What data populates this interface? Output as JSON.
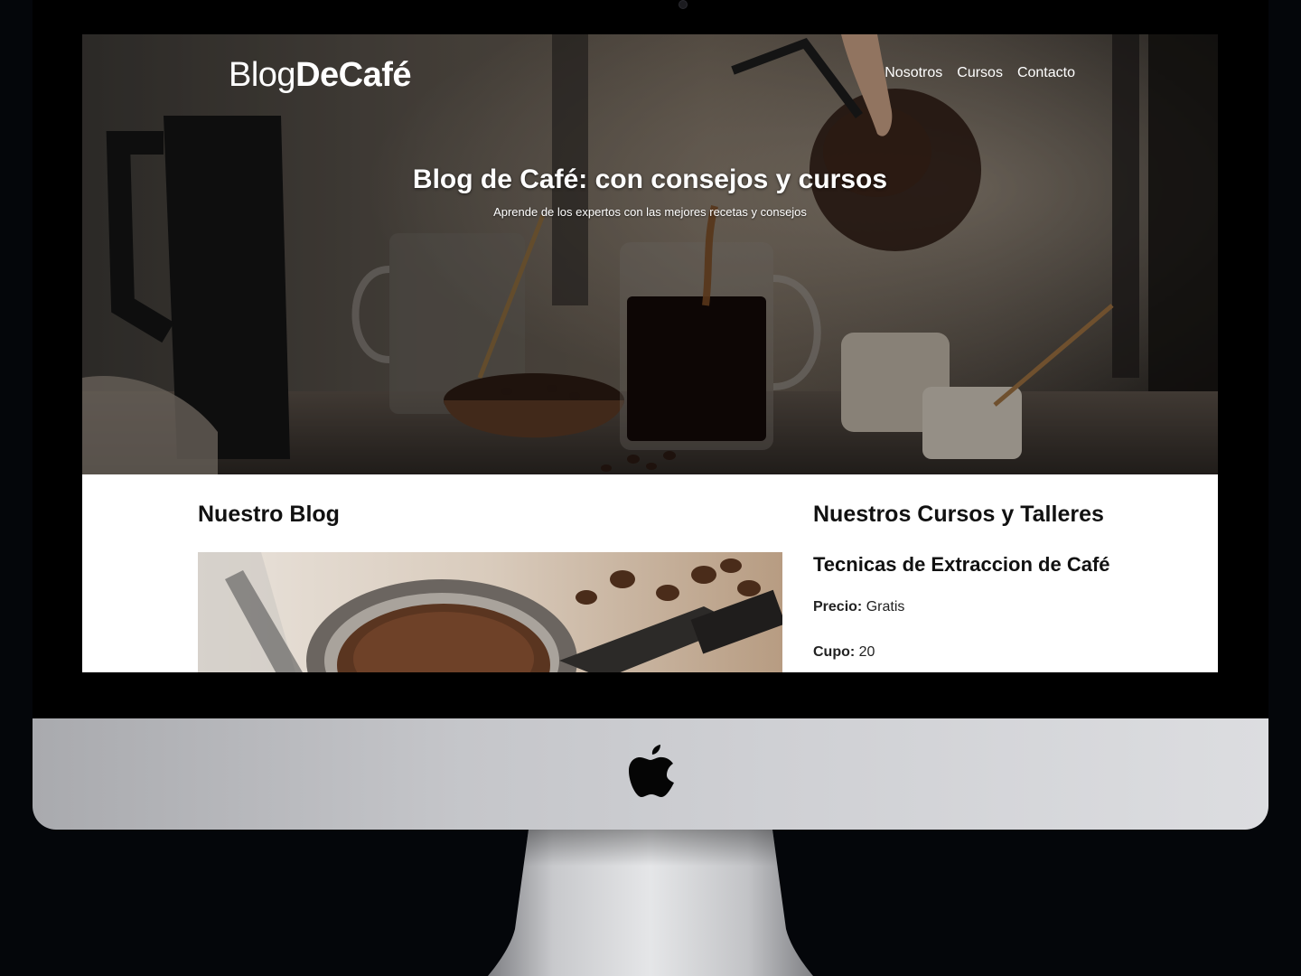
{
  "site": {
    "logo_light": "Blog",
    "logo_bold": "DeCafé",
    "nav": [
      {
        "label": "Nosotros"
      },
      {
        "label": "Cursos"
      },
      {
        "label": "Contacto"
      }
    ]
  },
  "hero": {
    "title": "Blog de Café: con consejos y cursos",
    "subtitle": "Aprende de los expertos con las mejores recetas y consejos"
  },
  "blog": {
    "heading": "Nuestro Blog"
  },
  "courses": {
    "heading": "Nuestros Cursos y Talleres",
    "items": [
      {
        "title": "Tecnicas de Extraccion de Café",
        "price_label": "Precio:",
        "price_value": "Gratis",
        "cupo_label": "Cupo:",
        "cupo_value": "20"
      }
    ]
  },
  "device": {
    "logo_icon": "apple-logo-icon"
  }
}
